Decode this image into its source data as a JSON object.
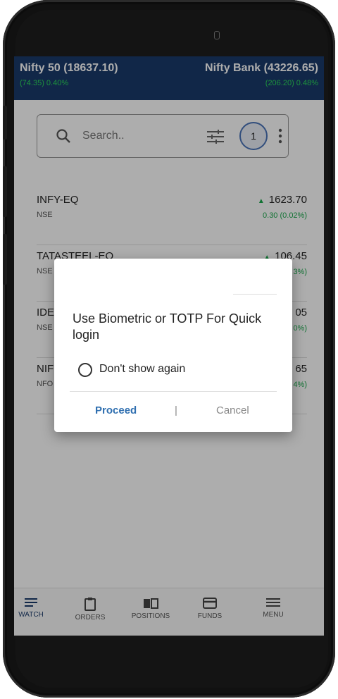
{
  "indices": [
    {
      "name": "Nifty 50 (18637.10)",
      "change": "(74.35) 0.40%"
    },
    {
      "name": "Nifty Bank (43226.65)",
      "change": "(206.20) 0.48%"
    }
  ],
  "search": {
    "placeholder": "Search..",
    "badge": "1"
  },
  "watchlist": [
    {
      "symbol": "INFY-EQ",
      "exchange": "NSE",
      "price": "1623.70",
      "change": "0.30 (0.02%)"
    },
    {
      "symbol": "TATASTEEL-EQ",
      "exchange": "NSE",
      "price": "106.45",
      "change": "3%)"
    },
    {
      "symbol": "IDE",
      "exchange": "NSE",
      "price": "05",
      "change": "0%)"
    },
    {
      "symbol": "NIF",
      "exchange": "NFO",
      "price": "65",
      "change": "4%)"
    }
  ],
  "dialog": {
    "message": "Use Biometric or TOTP For Quick login",
    "checkbox_label": "Don't show again",
    "proceed": "Proceed",
    "separator": "|",
    "cancel": "Cancel"
  },
  "nav": [
    {
      "label": "WATCH",
      "icon": "watch-list-icon",
      "active": true
    },
    {
      "label": "ORDERS",
      "icon": "clipboard-icon",
      "active": false
    },
    {
      "label": "POSITIONS",
      "icon": "book-icon",
      "active": false
    },
    {
      "label": "FUNDS",
      "icon": "card-icon",
      "active": false
    },
    {
      "label": "MENU",
      "icon": "menu-icon",
      "active": false
    }
  ],
  "colors": {
    "header": "#1a3a6b",
    "positive": "#1aa94c",
    "accent": "#2f6fb0"
  }
}
